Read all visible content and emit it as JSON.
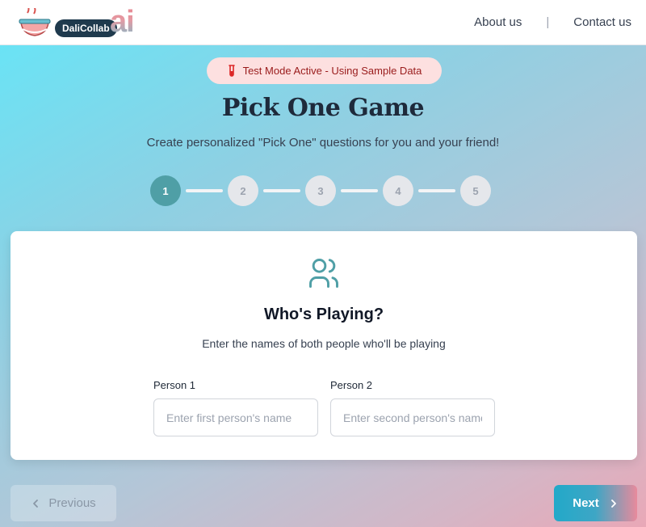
{
  "header": {
    "logo_text": "DaliCollab",
    "logo_suffix": "ai",
    "nav": [
      {
        "label": "About us"
      },
      {
        "label": "Contact us"
      }
    ],
    "nav_separator": "|"
  },
  "badge": {
    "icon": "test-tube-icon",
    "text": "Test Mode Active - Using Sample Data"
  },
  "page": {
    "title": "Pick One Game",
    "subtitle": "Create personalized \"Pick One\" questions for you and your friend!"
  },
  "stepper": {
    "current": 1,
    "steps": [
      "1",
      "2",
      "3",
      "4",
      "5"
    ]
  },
  "card": {
    "icon": "users-icon",
    "heading": "Who's Playing?",
    "description": "Enter the names of both people who'll be playing",
    "fields": [
      {
        "label": "Person 1",
        "placeholder": "Enter first person's name",
        "value": ""
      },
      {
        "label": "Person 2",
        "placeholder": "Enter second person's name",
        "value": ""
      }
    ]
  },
  "footer": {
    "previous_label": "Previous",
    "next_label": "Next"
  },
  "colors": {
    "accent": "#4f9fa6",
    "badge_bg": "#fde0e0",
    "badge_text": "#991b1b"
  }
}
